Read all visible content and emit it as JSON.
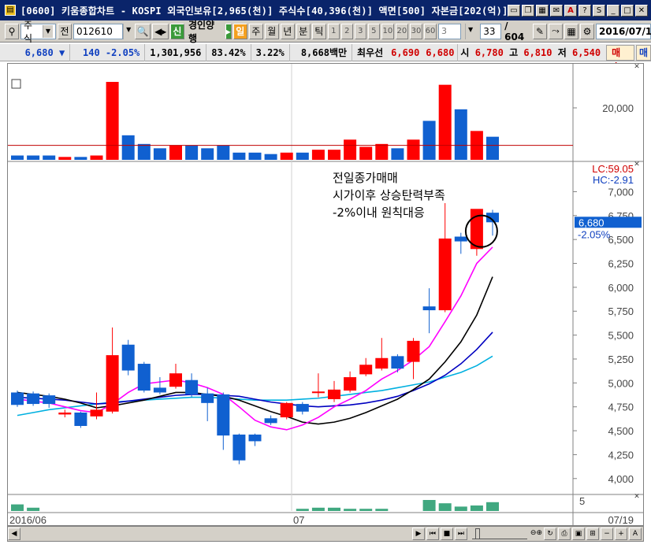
{
  "window": {
    "title": "[0600] 키움종합차트 - KOSPI 외국인보유[2,965(천)] 주식수[40,396(천)] 액면[500] 자본금[202(억)]",
    "title_suffix": "S"
  },
  "toolbar": {
    "market": "주식",
    "all_label": "전",
    "code": "012610",
    "new_label": "신",
    "stock_name": "경인양행",
    "period_tabs": [
      "일",
      "주",
      "월",
      "년",
      "분",
      "틱"
    ],
    "interval_buttons": [
      "1",
      "2",
      "3",
      "5",
      "10",
      "20",
      "30",
      "60",
      "3"
    ],
    "count_value": "33",
    "count_total": "/ 604",
    "date_value": "2016/07/1"
  },
  "quote": {
    "price": "6,680",
    "direction": "▼",
    "change": "140",
    "change_pct": "-2.05%",
    "volume": "1,301,956",
    "vol_ratio": "83.42%",
    "turnover": "3.22%",
    "amount": "8,668백만",
    "best_label": "최우선",
    "best_ask": "6,690",
    "best_bid": "6,680",
    "open_label": "시",
    "open": "6,780",
    "high_label": "고",
    "high": "6,810",
    "low_label": "저",
    "low": "6,540",
    "buy_button": "매수",
    "sell_button": "매"
  },
  "chart_data": {
    "type": "candlestick",
    "colors": {
      "up": "#ff0000",
      "down": "#1060d0",
      "ma5": "#ff00ff",
      "ma10": "#000000",
      "ma20": "#0000c0",
      "ma60": "#00b0e0",
      "volume_line": "#c00000"
    },
    "price_axis": {
      "ticks": [
        "7,000",
        "6,750",
        "6,500",
        "6,250",
        "6,000",
        "5,750",
        "5,500",
        "5,250",
        "5,000",
        "4,750",
        "4,500",
        "4,250",
        "4,000"
      ],
      "ylim": [
        3850,
        7300
      ]
    },
    "upper_limit_label": "LC:59.05",
    "high_change_label": "HC:-2.91",
    "current_price_label": "6,680",
    "current_pct_label": "-2.05%",
    "volume_axis_tick": "20,000",
    "investor_axis_tick": "5",
    "x_labels": [
      "2016/06",
      "07",
      "07/19"
    ],
    "annotation": [
      "전일종가매매",
      "시가이후 상승탄력부족",
      "-2%이내 원칙대응"
    ],
    "candles": [
      {
        "o": 4900,
        "h": 4920,
        "l": 4750,
        "c": 4770
      },
      {
        "o": 4890,
        "h": 4910,
        "l": 4760,
        "c": 4780
      },
      {
        "o": 4870,
        "h": 4890,
        "l": 4740,
        "c": 4780
      },
      {
        "o": 4670,
        "h": 4720,
        "l": 4640,
        "c": 4690
      },
      {
        "o": 4690,
        "h": 4700,
        "l": 4530,
        "c": 4550
      },
      {
        "o": 4650,
        "h": 4900,
        "l": 4620,
        "c": 4720
      },
      {
        "o": 4700,
        "h": 5580,
        "l": 4680,
        "c": 5290
      },
      {
        "o": 5400,
        "h": 5450,
        "l": 5080,
        "c": 5130
      },
      {
        "o": 5200,
        "h": 5220,
        "l": 4900,
        "c": 4920
      },
      {
        "o": 4950,
        "h": 5060,
        "l": 4880,
        "c": 4900
      },
      {
        "o": 4960,
        "h": 5200,
        "l": 4940,
        "c": 5100
      },
      {
        "o": 5030,
        "h": 5100,
        "l": 4850,
        "c": 4880
      },
      {
        "o": 4890,
        "h": 4950,
        "l": 4600,
        "c": 4790
      },
      {
        "o": 4880,
        "h": 4900,
        "l": 4300,
        "c": 4450
      },
      {
        "o": 4460,
        "h": 4470,
        "l": 4150,
        "c": 4190
      },
      {
        "o": 4460,
        "h": 4470,
        "l": 4340,
        "c": 4390
      },
      {
        "o": 4630,
        "h": 4660,
        "l": 4560,
        "c": 4580
      },
      {
        "o": 4640,
        "h": 4800,
        "l": 4620,
        "c": 4790
      },
      {
        "o": 4780,
        "h": 4800,
        "l": 4670,
        "c": 4700
      },
      {
        "o": 4900,
        "h": 5100,
        "l": 4850,
        "c": 4910
      },
      {
        "o": 4830,
        "h": 5020,
        "l": 4800,
        "c": 4930
      },
      {
        "o": 4920,
        "h": 5120,
        "l": 4900,
        "c": 5060
      },
      {
        "o": 5090,
        "h": 5260,
        "l": 5070,
        "c": 5190
      },
      {
        "o": 5150,
        "h": 5470,
        "l": 5130,
        "c": 5260
      },
      {
        "o": 5280,
        "h": 5300,
        "l": 5110,
        "c": 5150
      },
      {
        "o": 5220,
        "h": 5470,
        "l": 5040,
        "c": 5440
      },
      {
        "o": 5800,
        "h": 5990,
        "l": 5520,
        "c": 5760
      },
      {
        "o": 5760,
        "h": 6880,
        "l": 5740,
        "c": 6510
      },
      {
        "o": 6530,
        "h": 6570,
        "l": 6350,
        "c": 6480
      },
      {
        "o": 6400,
        "h": 6810,
        "l": 6330,
        "c": 6820
      },
      {
        "o": 6780,
        "h": 6810,
        "l": 6540,
        "c": 6680
      }
    ],
    "ma5": [
      4830,
      4810,
      4790,
      4750,
      4710,
      4690,
      4780,
      4900,
      4990,
      5010,
      5030,
      5000,
      4950,
      4880,
      4750,
      4610,
      4540,
      4510,
      4560,
      4640,
      4750,
      4830,
      4920,
      5040,
      5130,
      5240,
      5380,
      5640,
      5910,
      6250,
      6420
    ],
    "ma10": [
      4900,
      4880,
      4860,
      4830,
      4790,
      4740,
      4760,
      4790,
      4820,
      4860,
      4900,
      4900,
      4880,
      4860,
      4820,
      4760,
      4700,
      4650,
      4590,
      4570,
      4590,
      4630,
      4690,
      4760,
      4830,
      4930,
      5040,
      5220,
      5430,
      5710,
      6110
    ],
    "ma20": [
      4850,
      4840,
      4830,
      4820,
      4800,
      4780,
      4790,
      4810,
      4830,
      4850,
      4870,
      4880,
      4880,
      4870,
      4860,
      4830,
      4800,
      4780,
      4760,
      4750,
      4760,
      4770,
      4790,
      4820,
      4860,
      4920,
      4990,
      5080,
      5200,
      5350,
      5530
    ],
    "ma60": [
      4660,
      4690,
      4720,
      4740,
      4760,
      4780,
      4800,
      4810,
      4820,
      4830,
      4840,
      4850,
      4850,
      4840,
      4830,
      4820,
      4820,
      4820,
      4830,
      4840,
      4860,
      4880,
      4900,
      4920,
      4950,
      4980,
      5010,
      5060,
      5110,
      5180,
      5280
    ],
    "volume": [
      300,
      300,
      300,
      200,
      200,
      300,
      5400,
      1700,
      1100,
      800,
      1000,
      1000,
      800,
      1000,
      500,
      500,
      400,
      500,
      500,
      700,
      700,
      1400,
      900,
      1100,
      800,
      1400,
      2700,
      5200,
      3500,
      2000,
      1600
    ],
    "investor": [
      0.6,
      0.3,
      0,
      0,
      0,
      0,
      0,
      0,
      0,
      0,
      0,
      0,
      0,
      0,
      0,
      0,
      0,
      0,
      0.2,
      0.3,
      0.3,
      0.2,
      0.2,
      0.2,
      0,
      0,
      1.0,
      0.7,
      0.4,
      0.5,
      0.8
    ]
  }
}
